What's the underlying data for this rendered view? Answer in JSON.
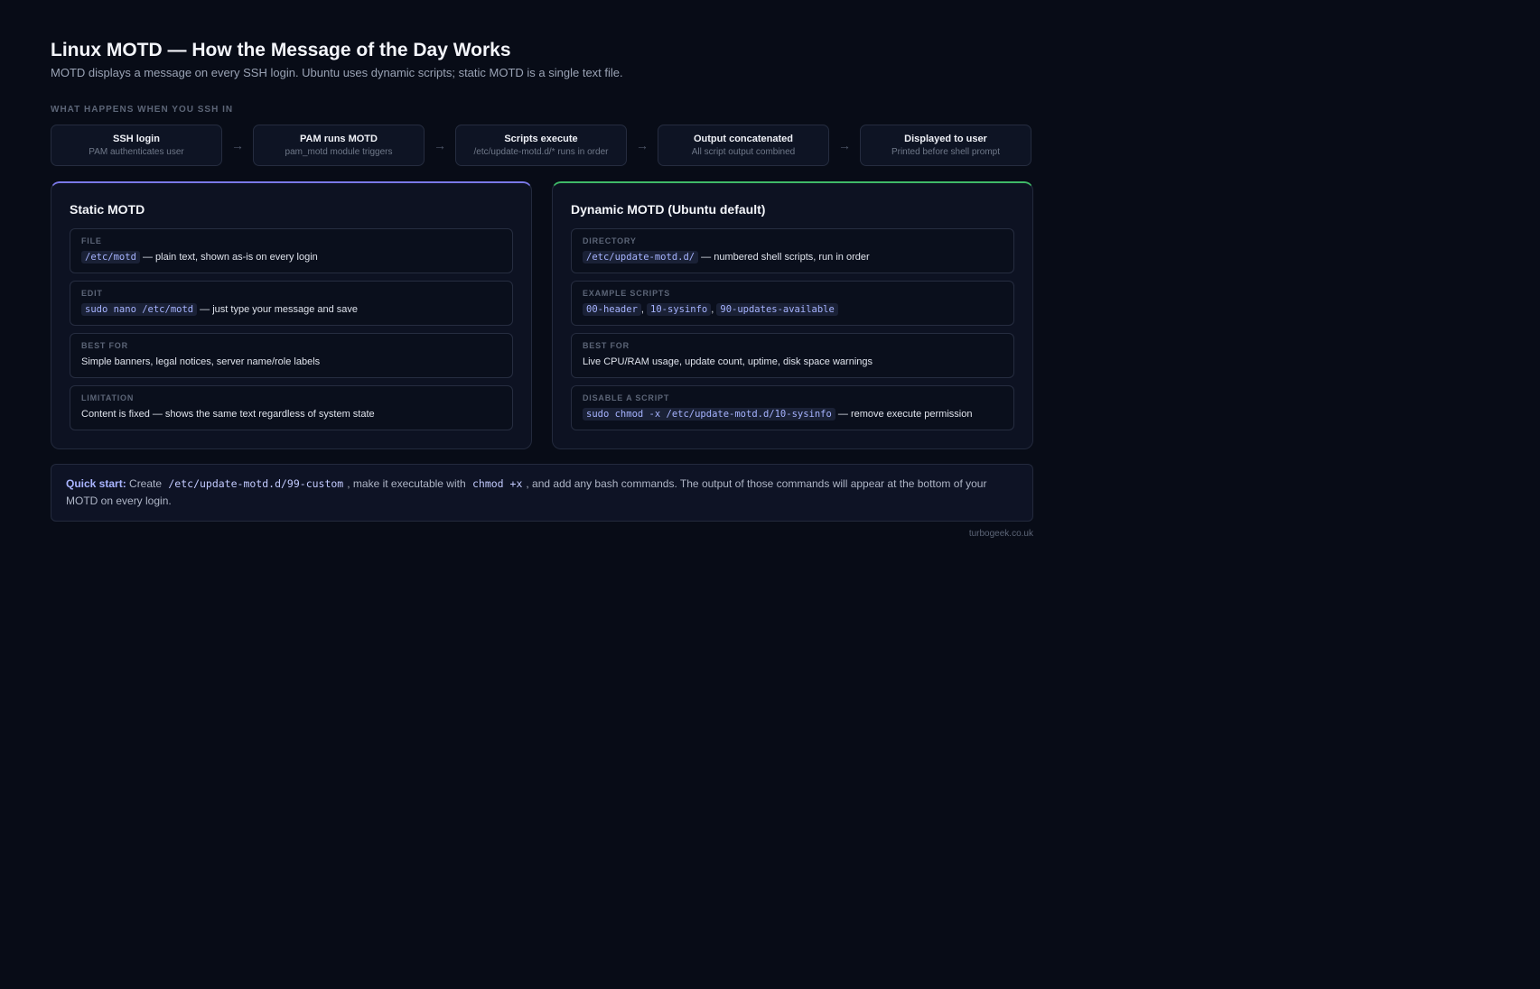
{
  "header": {
    "title": "Linux MOTD — How the Message of the Day Works",
    "subtitle": "MOTD displays a message on every SSH login. Ubuntu uses dynamic scripts; static MOTD is a single text file."
  },
  "flow": {
    "label": "WHAT HAPPENS WHEN YOU SSH IN",
    "arrow": "→",
    "steps": [
      {
        "title": "SSH login",
        "sub": "PAM authenticates user"
      },
      {
        "title": "PAM runs MOTD",
        "sub": "pam_motd module triggers"
      },
      {
        "title": "Scripts execute",
        "sub": "/etc/update-motd.d/* runs in order"
      },
      {
        "title": "Output concatenated",
        "sub": "All script output combined"
      },
      {
        "title": "Displayed to user",
        "sub": "Printed before shell prompt"
      }
    ]
  },
  "static": {
    "title": "Static MOTD",
    "accent": "#7a78e8",
    "file": {
      "label": "FILE",
      "code": "/etc/motd",
      "text": " — plain text, shown as-is on every login"
    },
    "edit": {
      "label": "EDIT",
      "code": "sudo nano /etc/motd",
      "text": " — just type your message and save"
    },
    "best": {
      "label": "BEST FOR",
      "text": "Simple banners, legal notices, server name/role labels"
    },
    "limit": {
      "label": "LIMITATION",
      "text": "Content is fixed — shows the same text regardless of system state"
    }
  },
  "dynamic": {
    "title": "Dynamic MOTD (Ubuntu default)",
    "accent": "#3fba68",
    "dir": {
      "label": "DIRECTORY",
      "code": "/etc/update-motd.d/",
      "text": " — numbered shell scripts, run in order"
    },
    "examples": {
      "label": "EXAMPLE SCRIPTS",
      "s1": "00-header",
      "s2": "10-sysinfo",
      "s3": "90-updates-available",
      "sep": ", "
    },
    "best": {
      "label": "BEST FOR",
      "text": "Live CPU/RAM usage, update count, uptime, disk space warnings"
    },
    "disable": {
      "label": "DISABLE A SCRIPT",
      "code": "sudo chmod -x /etc/update-motd.d/10-sysinfo",
      "text": " — remove execute permission"
    }
  },
  "quick": {
    "label": "Quick start:",
    "t1": " Create ",
    "c1": "/etc/update-motd.d/99-custom",
    "t2": ", make it executable with ",
    "c2": "chmod +x",
    "t3": ", and add any bash commands. The output of those commands will appear at the bottom of your MOTD on every login."
  },
  "credit": "turbogeek.co.uk"
}
